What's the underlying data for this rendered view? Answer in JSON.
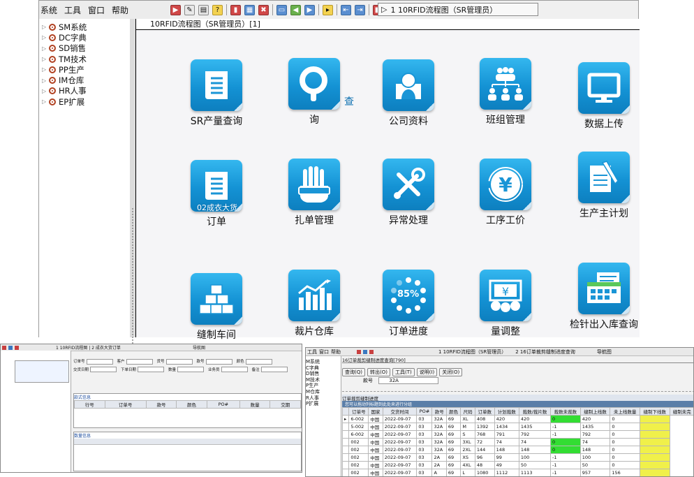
{
  "menu": [
    "系统",
    "工具",
    "窗口",
    "帮助"
  ],
  "window_tab": "1 10RFID流程图（SR管理员）",
  "content_title": "10RFID流程图（SR管理员）[1]",
  "tree": [
    {
      "label": "SM系统"
    },
    {
      "label": "DC字典"
    },
    {
      "label": "SD销售"
    },
    {
      "label": "TM技术"
    },
    {
      "label": "PP生产"
    },
    {
      "label": "IM仓库"
    },
    {
      "label": "HR人事"
    },
    {
      "label": "EP扩展"
    }
  ],
  "tiles": [
    {
      "label": "SR产量查询",
      "icon": "document-icon"
    },
    {
      "label": "询",
      "overlay": "查",
      "icon": "search-icon"
    },
    {
      "label": "公司资料",
      "icon": "person-icon"
    },
    {
      "label": "班组管理",
      "icon": "org-chart-icon"
    },
    {
      "label": "数据上传",
      "icon": "monitor-icon"
    },
    {
      "label": "订单",
      "overlay": "02成衣大货",
      "icon": "document-icon"
    },
    {
      "label": "扎单管理",
      "icon": "hand-icon"
    },
    {
      "label": "异常处理",
      "icon": "tools-icon"
    },
    {
      "label": "工序工价",
      "icon": "yen-icon"
    },
    {
      "label": "生产主计划",
      "icon": "notepad-pen-icon"
    },
    {
      "label": "缝制车间",
      "icon": "boxes-icon"
    },
    {
      "label": "裁片仓库",
      "icon": "bar-chart-icon"
    },
    {
      "label": "订单进度",
      "overlay": "85%",
      "icon": "progress-ring-icon"
    },
    {
      "label": "量调整",
      "icon": "money-icon"
    },
    {
      "label": "检针出入库查询",
      "icon": "calendar-card-icon"
    }
  ],
  "shot2": {
    "menu": [
      "工具",
      "窗口",
      "帮助"
    ],
    "tab1": "1 10RFID流程图（SR管理员）",
    "tab2": "2 16订单裁剪缝制进度查询",
    "nav": "导航图",
    "tree": [
      "M系统",
      "C字典",
      "D销售",
      "M技术",
      "P生产",
      "M仓库",
      "R人事",
      "P扩展"
    ],
    "sub_title": "16订单裁剪缝制进度查询[790]",
    "buttons": [
      "查询(Q)",
      "转出(O)",
      "工具(T)",
      "说明(I)",
      "关闭(O)"
    ],
    "field_label": "款号",
    "field_value": "32A",
    "group_title": "订单裁剪缝制进度",
    "hint": "您可以拖动列标题到此处来进行分组",
    "headers": [
      "订单号",
      "国家",
      "交货时间",
      "PO#",
      "款号",
      "颜色",
      "尺码",
      "订单数",
      "计划裁数",
      "裁数/裁片数",
      "裁数未裁数",
      "缝制上线数",
      "未上线数量",
      "缝制下线数",
      "缝制未完"
    ],
    "rows": [
      [
        "6-002",
        "中国",
        "2022-09-07",
        "03",
        "32A",
        "69",
        "XL",
        "408",
        "420",
        "420",
        "0",
        "420",
        "0"
      ],
      [
        "5-002",
        "中国",
        "2022-09-07",
        "03",
        "32A",
        "69",
        "M",
        "1392",
        "1434",
        "1435",
        "-1",
        "1435",
        "0"
      ],
      [
        "6-002",
        "中国",
        "2022-09-07",
        "03",
        "32A",
        "69",
        "S",
        "768",
        "791",
        "792",
        "-1",
        "792",
        "0"
      ],
      [
        "002",
        "中国",
        "2022-09-07",
        "03",
        "32A",
        "69",
        "3XL",
        "72",
        "74",
        "74",
        "0",
        "74",
        "0"
      ],
      [
        "002",
        "中国",
        "2022-09-07",
        "03",
        "32A",
        "69",
        "2XL",
        "144",
        "148",
        "148",
        "0",
        "148",
        "0"
      ],
      [
        "002",
        "中国",
        "2022-09-07",
        "03",
        "2A",
        "69",
        "XS",
        "96",
        "99",
        "100",
        "-1",
        "100",
        "0"
      ],
      [
        "002",
        "中国",
        "2022-09-07",
        "03",
        "2A",
        "69",
        "4XL",
        "48",
        "49",
        "50",
        "-1",
        "50",
        "0"
      ],
      [
        "002",
        "中国",
        "2022-09-07",
        "03",
        "A",
        "69",
        "L",
        "1080",
        "1112",
        "1113",
        "-1",
        "957",
        "156"
      ]
    ]
  },
  "shot1": {
    "toolbar_text": "1 10RFID流程图 | 2 成衣大货订单",
    "nav": "导航图",
    "fields": [
      "订单号",
      "客户",
      "货号",
      "款号",
      "颜色",
      "交货日期",
      "下单日期",
      "数量",
      "业务员",
      "备注"
    ],
    "table_headers": [
      "行号",
      "订单号",
      "款号",
      "颜色",
      "PO#",
      "数量",
      "交期"
    ],
    "section1": "款式信息",
    "section2": "数量信息"
  }
}
